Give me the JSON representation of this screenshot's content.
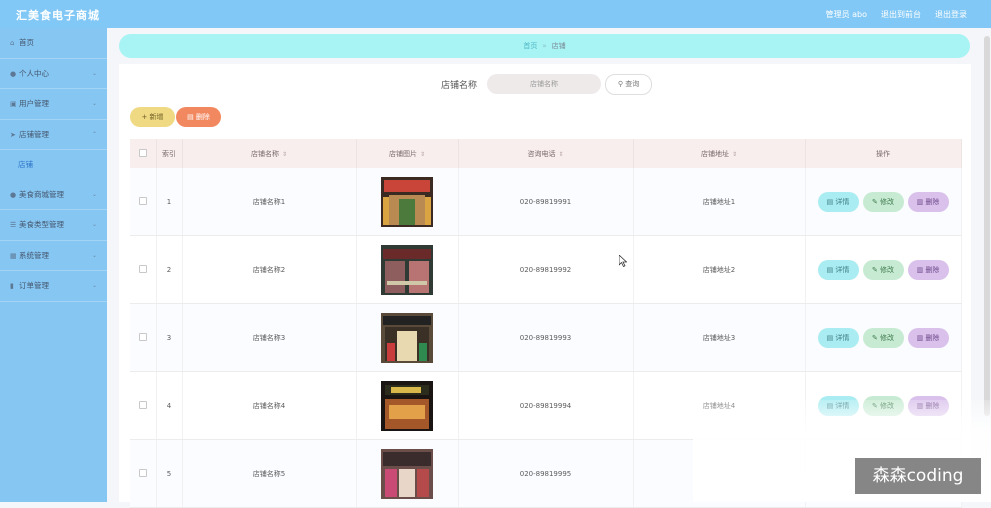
{
  "app": {
    "title": "汇美食电子商城"
  },
  "topbar": {
    "admin": "管理员 abo",
    "back": "退出到前台",
    "logout": "退出登录"
  },
  "sidebar": {
    "items": [
      {
        "label": "首页",
        "icon": "home-icon"
      },
      {
        "label": "个人中心",
        "icon": "user-icon"
      },
      {
        "label": "用户管理",
        "icon": "users-icon"
      },
      {
        "label": "店铺管理",
        "icon": "send-icon"
      },
      {
        "label": "店铺",
        "sub": true
      },
      {
        "label": "美食商城管理",
        "icon": "location-icon"
      },
      {
        "label": "美食类型管理",
        "icon": "list-icon"
      },
      {
        "label": "系统管理",
        "icon": "grid-icon"
      },
      {
        "label": "订单管理",
        "icon": "chart-icon"
      }
    ]
  },
  "breadcrumb": {
    "home": "首页",
    "sep": "»",
    "current": "店铺"
  },
  "search": {
    "label": "店铺名称",
    "placeholder": "店铺名称",
    "button": "查询"
  },
  "actions": {
    "add": "新增",
    "delete": "删除"
  },
  "table": {
    "headers": {
      "index": "索引",
      "name": "店铺名称",
      "image": "店铺图片",
      "phone": "咨询电话",
      "address": "店铺地址",
      "ops": "操作"
    },
    "op_labels": {
      "detail": "详情",
      "edit": "修改",
      "remove": "删除"
    },
    "rows": [
      {
        "index": "1",
        "name": "店铺名称1",
        "phone": "020-89819991",
        "address": "店铺地址1"
      },
      {
        "index": "2",
        "name": "店铺名称2",
        "phone": "020-89819992",
        "address": "店铺地址2"
      },
      {
        "index": "3",
        "name": "店铺名称3",
        "phone": "020-89819993",
        "address": "店铺地址3"
      },
      {
        "index": "4",
        "name": "店铺名称4",
        "phone": "020-89819994",
        "address": "店铺地址4"
      },
      {
        "index": "5",
        "name": "店铺名称5",
        "phone": "020-89819995",
        "address": ""
      }
    ]
  },
  "watermark": "森森coding",
  "colors": {
    "topbar": "#82c8f6",
    "sidebar": "#86c6f2",
    "breadcrumb": "#a8f4f4",
    "add": "#efd983",
    "delete": "#f28860"
  }
}
